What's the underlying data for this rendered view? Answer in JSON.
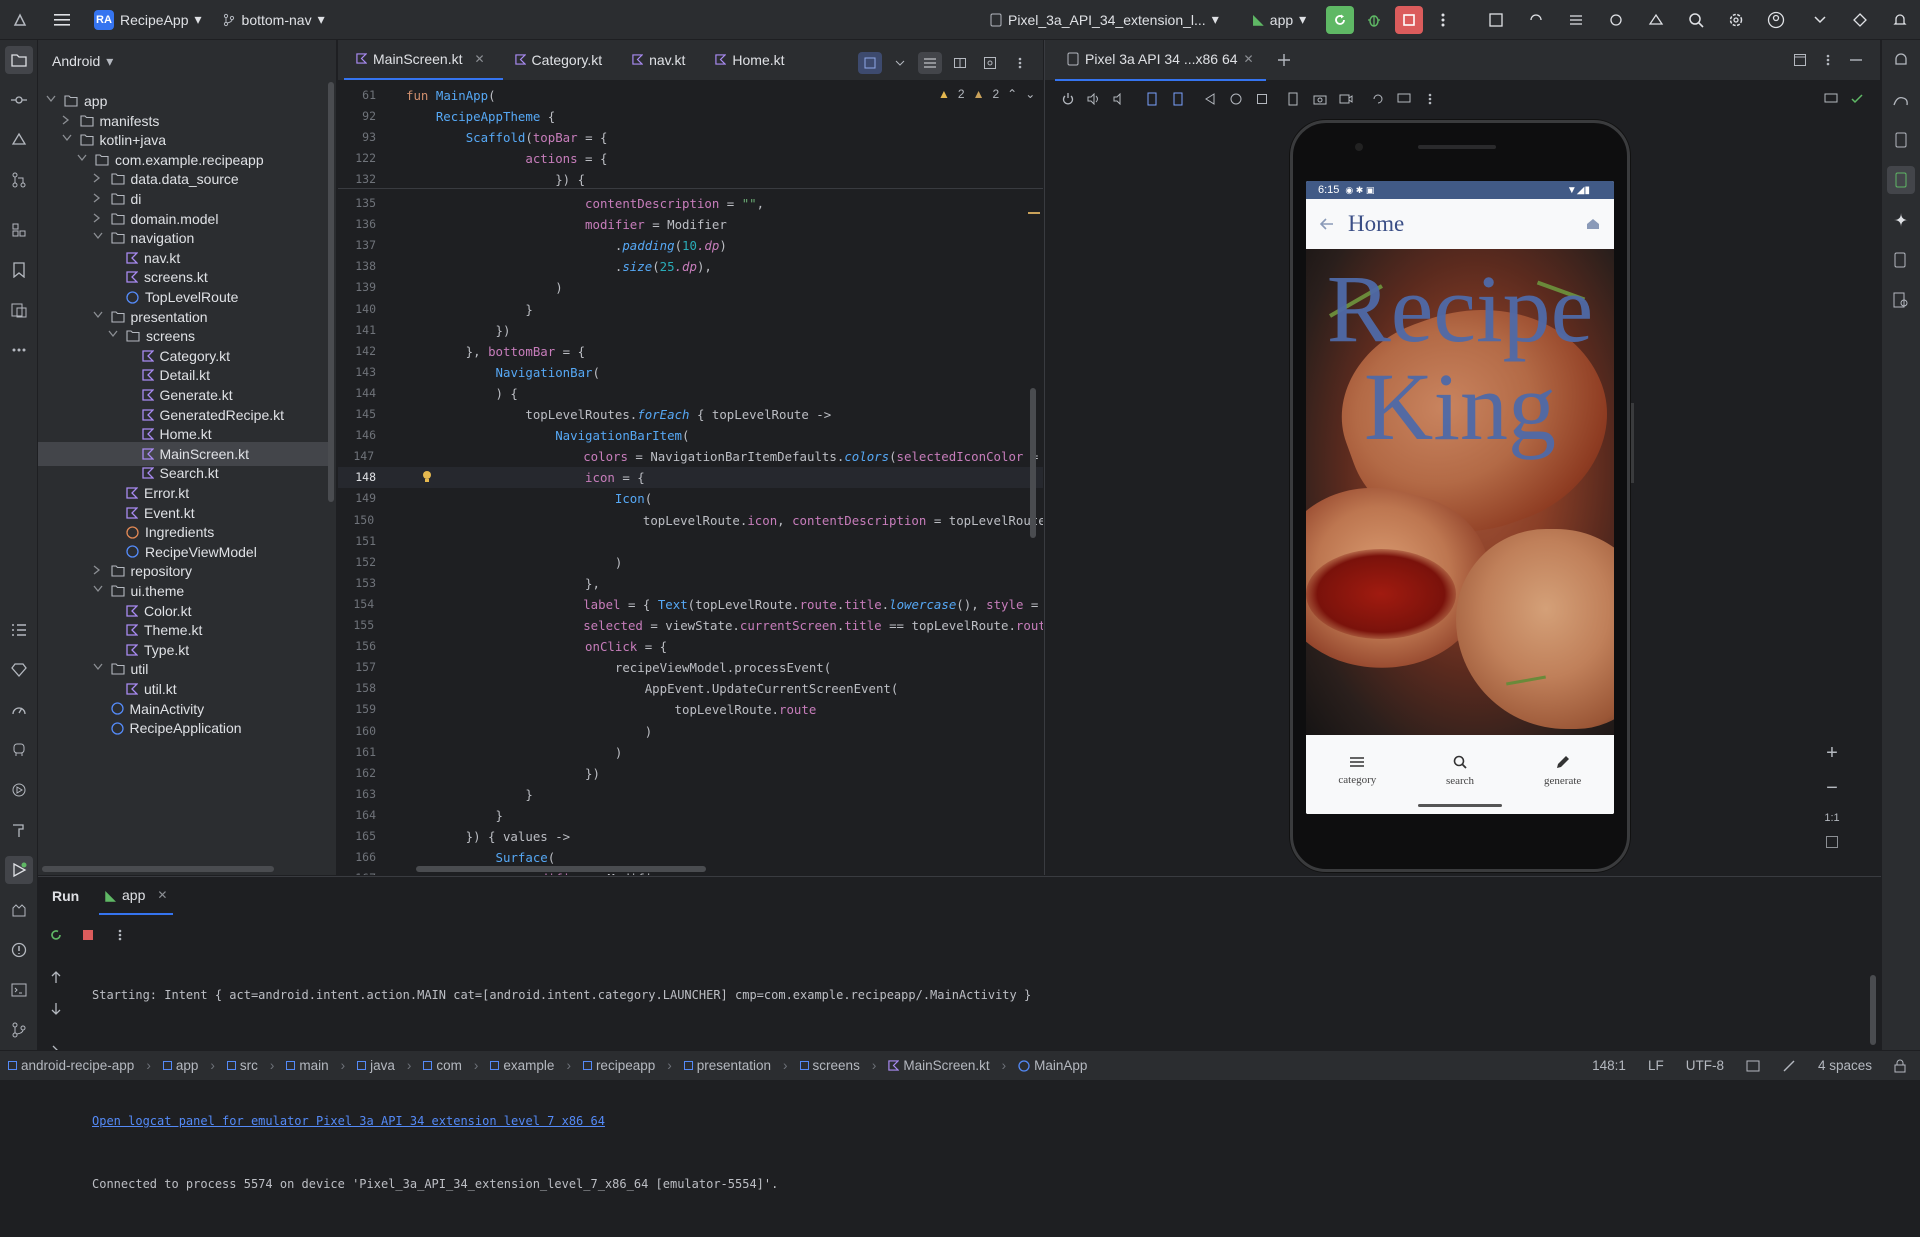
{
  "topbar": {
    "project_badge": "RA",
    "project_name": "RecipeApp",
    "branch": "bottom-nav",
    "device_selector": "Pixel_3a_API_34_extension_l...",
    "run_config": "app"
  },
  "project_panel": {
    "view_mode": "Android",
    "tree": [
      {
        "label": "app",
        "depth": 0,
        "type": "module",
        "expanded": true
      },
      {
        "label": "manifests",
        "depth": 1,
        "type": "folder",
        "expanded": false
      },
      {
        "label": "kotlin+java",
        "depth": 1,
        "type": "folder",
        "expanded": true
      },
      {
        "label": "com.example.recipeapp",
        "depth": 2,
        "type": "package",
        "expanded": true
      },
      {
        "label": "data.data_source",
        "depth": 3,
        "type": "package",
        "expanded": false
      },
      {
        "label": "di",
        "depth": 3,
        "type": "package",
        "expanded": false
      },
      {
        "label": "domain.model",
        "depth": 3,
        "type": "package",
        "expanded": false
      },
      {
        "label": "navigation",
        "depth": 3,
        "type": "package",
        "expanded": true
      },
      {
        "label": "nav.kt",
        "depth": 4,
        "type": "kotlin"
      },
      {
        "label": "screens.kt",
        "depth": 4,
        "type": "kotlin"
      },
      {
        "label": "TopLevelRoute",
        "depth": 4,
        "type": "class"
      },
      {
        "label": "presentation",
        "depth": 3,
        "type": "package",
        "expanded": true
      },
      {
        "label": "screens",
        "depth": 4,
        "type": "package",
        "expanded": true
      },
      {
        "label": "Category.kt",
        "depth": 5,
        "type": "kotlin"
      },
      {
        "label": "Detail.kt",
        "depth": 5,
        "type": "kotlin"
      },
      {
        "label": "Generate.kt",
        "depth": 5,
        "type": "kotlin"
      },
      {
        "label": "GeneratedRecipe.kt",
        "depth": 5,
        "type": "kotlin"
      },
      {
        "label": "Home.kt",
        "depth": 5,
        "type": "kotlin"
      },
      {
        "label": "MainScreen.kt",
        "depth": 5,
        "type": "kotlin",
        "selected": true
      },
      {
        "label": "Search.kt",
        "depth": 5,
        "type": "kotlin"
      },
      {
        "label": "Error.kt",
        "depth": 4,
        "type": "kotlin"
      },
      {
        "label": "Event.kt",
        "depth": 4,
        "type": "kotlin"
      },
      {
        "label": "Ingredients",
        "depth": 4,
        "type": "interface"
      },
      {
        "label": "RecipeViewModel",
        "depth": 4,
        "type": "class"
      },
      {
        "label": "repository",
        "depth": 3,
        "type": "package",
        "expanded": false
      },
      {
        "label": "ui.theme",
        "depth": 3,
        "type": "package",
        "expanded": true
      },
      {
        "label": "Color.kt",
        "depth": 4,
        "type": "kotlin"
      },
      {
        "label": "Theme.kt",
        "depth": 4,
        "type": "kotlin"
      },
      {
        "label": "Type.kt",
        "depth": 4,
        "type": "kotlin"
      },
      {
        "label": "util",
        "depth": 3,
        "type": "package",
        "expanded": true
      },
      {
        "label": "util.kt",
        "depth": 4,
        "type": "kotlin"
      },
      {
        "label": "MainActivity",
        "depth": 3,
        "type": "class"
      },
      {
        "label": "RecipeApplication",
        "depth": 3,
        "type": "class"
      }
    ]
  },
  "editor": {
    "tabs": [
      {
        "label": "MainScreen.kt",
        "active": true
      },
      {
        "label": "Category.kt",
        "active": false
      },
      {
        "label": "nav.kt",
        "active": false
      },
      {
        "label": "Home.kt",
        "active": false
      }
    ],
    "inspections": {
      "warnings": "2",
      "weak_warnings": "2"
    },
    "sticky_lines": [
      {
        "n": "61",
        "code": "fun MainApp("
      },
      {
        "n": "92",
        "code": "    RecipeAppTheme {"
      },
      {
        "n": "93",
        "code": "        Scaffold(topBar = {"
      },
      {
        "n": "122",
        "code": "                actions = {"
      },
      {
        "n": "132",
        "code": "                    }) {"
      }
    ],
    "lines": [
      {
        "n": "135",
        "code": "                        contentDescription = \"\","
      },
      {
        "n": "136",
        "code": "                        modifier = Modifier"
      },
      {
        "n": "137",
        "code": "                            .padding(10.dp)"
      },
      {
        "n": "138",
        "code": "                            .size(25.dp),"
      },
      {
        "n": "139",
        "code": "                    )"
      },
      {
        "n": "140",
        "code": "                }"
      },
      {
        "n": "141",
        "code": "            })"
      },
      {
        "n": "142",
        "code": "        }, bottomBar = {"
      },
      {
        "n": "143",
        "code": "            NavigationBar("
      },
      {
        "n": "144",
        "code": "            ) {"
      },
      {
        "n": "145",
        "code": "                topLevelRoutes.forEach { topLevelRoute ->"
      },
      {
        "n": "146",
        "code": "                    NavigationBarItem("
      },
      {
        "n": "147",
        "code": "                        colors = NavigationBarItemDefaults.colors(selectedIconColor = Mate"
      },
      {
        "n": "148",
        "code": "                        icon = {"
      },
      {
        "n": "149",
        "code": "                            Icon("
      },
      {
        "n": "150",
        "code": "                                topLevelRoute.icon, contentDescription = topLevelRoute.rou"
      },
      {
        "n": "151",
        "code": ""
      },
      {
        "n": "152",
        "code": "                            )"
      },
      {
        "n": "153",
        "code": "                        },"
      },
      {
        "n": "154",
        "code": "                        label = { Text(topLevelRoute.route.title.lowercase(), style = Text"
      },
      {
        "n": "155",
        "code": "                        selected = viewState.currentScreen.title == topLevelRoute.route.ti"
      },
      {
        "n": "156",
        "code": "                        onClick = {"
      },
      {
        "n": "157",
        "code": "                            recipeViewModel.processEvent("
      },
      {
        "n": "158",
        "code": "                                AppEvent.UpdateCurrentScreenEvent("
      },
      {
        "n": "159",
        "code": "                                    topLevelRoute.route"
      },
      {
        "n": "160",
        "code": "                                )"
      },
      {
        "n": "161",
        "code": "                            )"
      },
      {
        "n": "162",
        "code": "                        })"
      },
      {
        "n": "163",
        "code": "                }"
      },
      {
        "n": "164",
        "code": "            }"
      },
      {
        "n": "165",
        "code": "        }) { values ->"
      },
      {
        "n": "166",
        "code": "            Surface("
      },
      {
        "n": "167",
        "code": "                modifier = Modifier"
      }
    ],
    "current_line": "148"
  },
  "running_devices": {
    "tab_label": "Pixel 3a API 34 ...x86 64",
    "zoom_label": "1:1",
    "phone": {
      "status_time": "6:15",
      "app_title": "Home",
      "hero_line1": "Recipe",
      "hero_line2": "King",
      "nav_items": [
        {
          "label": "category",
          "icon": "list-icon"
        },
        {
          "label": "search",
          "icon": "search-icon"
        },
        {
          "label": "generate",
          "icon": "pencil-icon"
        }
      ]
    }
  },
  "run_panel": {
    "title": "Run",
    "config_tab": "app",
    "console": [
      "Starting: Intent { act=android.intent.action.MAIN cat=[android.intent.category.LAUNCHER] cmp=com.example.recipeapp/.MainActivity }",
      "",
      "Open logcat panel for emulator Pixel 3a API 34 extension level 7 x86 64",
      "Connected to process 5574 on device 'Pixel_3a_API_34_extension_level_7_x86_64 [emulator-5554]'."
    ]
  },
  "status_bar": {
    "breadcrumbs": [
      "android-recipe-app",
      "app",
      "src",
      "main",
      "java",
      "com",
      "example",
      "recipeapp",
      "presentation",
      "screens",
      "MainScreen.kt",
      "MainApp"
    ],
    "position": "148:1",
    "line_sep": "LF",
    "encoding": "UTF-8",
    "indent": "4 spaces"
  },
  "colors": {
    "accent": "#3574f0",
    "panel": "#2b2d30",
    "editor_bg": "#1e1f22",
    "run_green": "#5fb865",
    "stop_red": "#db5c5c",
    "phone_title_blue": "#4f6aa8"
  }
}
